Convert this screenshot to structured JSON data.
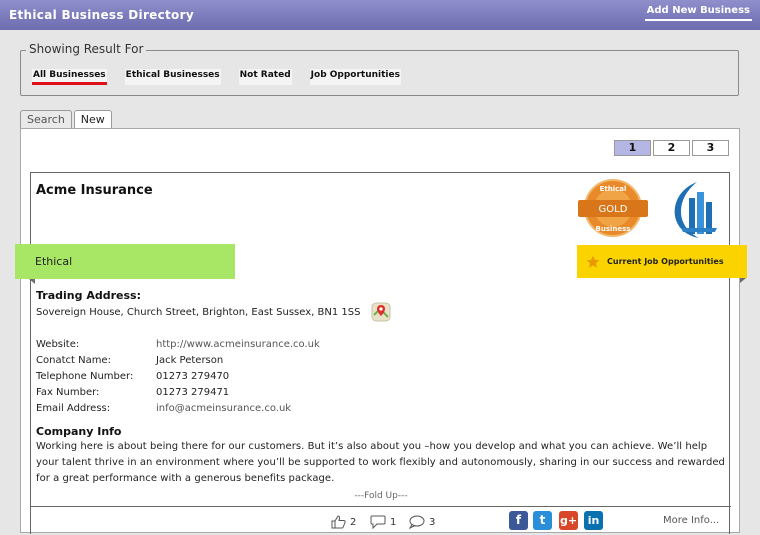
{
  "header": {
    "title": "Ethical Business Directory",
    "add_new_label": "Add New Business"
  },
  "filters": {
    "legend": "Showing Result For",
    "items": [
      {
        "label": "All Businesses",
        "active": true
      },
      {
        "label": "Ethical Businesses",
        "active": false
      },
      {
        "label": "Not Rated",
        "active": false
      },
      {
        "label": "Job Opportunities",
        "active": false
      }
    ]
  },
  "tabs": [
    {
      "label": "Search",
      "active": false
    },
    {
      "label": "New",
      "active": true
    }
  ],
  "pagination": {
    "pages": [
      "1",
      "2",
      "3"
    ],
    "current": "1"
  },
  "business": {
    "name": "Acme Insurance",
    "badge": {
      "top_text": "Ethical",
      "middle_text": "GOLD",
      "bottom_text": "Business",
      "color": "#e88a2a"
    },
    "logo_icon": "building-logo-icon",
    "ethical_ribbon": {
      "label": "Ethical",
      "color": "#a8e766"
    },
    "jobs_ribbon": {
      "label": "Current Job Opportunities",
      "color": "#fbd400",
      "icon": "star-icon"
    },
    "trading_address_label": "Trading Address:",
    "trading_address": "Sovereign House, Church Street, Brighton, East Sussex, BN1 1SS",
    "map_icon": "map-pin-icon",
    "details": [
      {
        "key": "Website:",
        "value": "http://www.acmeinsurance.co.uk",
        "link": true
      },
      {
        "key": "Conatct Name:",
        "value": "Jack Peterson",
        "link": false
      },
      {
        "key": "Telephone Number:",
        "value": "01273 279470",
        "link": false
      },
      {
        "key": "Fax Number:",
        "value": "01273 279471",
        "link": false
      },
      {
        "key": "Email Address:",
        "value": "info@acmeinsurance.co.uk",
        "link": true
      }
    ],
    "company_info_label": "Company Info",
    "company_info_text": "Working here is about being there for our customers. But it’s also about you –how you develop and what you can achieve. We’ll help your talent thrive in an environment where you’ll be supported to work flexibly and autonomously, sharing in our success and rewarded for a great performance with a generous benefits package.",
    "fold_label": "---Fold Up---"
  },
  "footer": {
    "likes": "2",
    "comments": "1",
    "messages": "3",
    "social": [
      {
        "name": "facebook",
        "glyph": "f",
        "color": "#3b5998"
      },
      {
        "name": "twitter",
        "glyph": "t",
        "color": "#2a8fd8"
      },
      {
        "name": "google-plus",
        "glyph": "g+",
        "color": "#d9472b"
      },
      {
        "name": "linkedin",
        "glyph": "in",
        "color": "#0a71b0"
      }
    ],
    "more_info_label": "More Info..."
  }
}
